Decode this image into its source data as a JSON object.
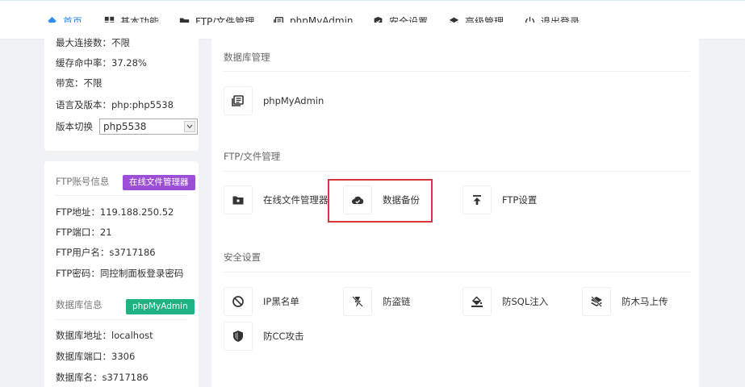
{
  "nav": {
    "items": [
      {
        "label": "首页",
        "icon": "home-icon"
      },
      {
        "label": "基本功能",
        "icon": "grid-icon"
      },
      {
        "label": "FTP/文件管理",
        "icon": "folder-icon"
      },
      {
        "label": "phpMyAdmin",
        "icon": "database-icon"
      },
      {
        "label": "安全设置",
        "icon": "shield-icon"
      },
      {
        "label": "高级管理",
        "icon": "layers-icon"
      },
      {
        "label": "退出登录",
        "icon": "power-icon"
      }
    ],
    "active_color": "#2d8cf0"
  },
  "left_top": {
    "max_conn": "最大连接数：不限",
    "cache_hit": "缓存命中率：37.28%",
    "bandwidth": "带宽：不限",
    "lang_version": "语言及版本：php:php5538",
    "version_switch_label": "版本切换",
    "version_selected": "php5538"
  },
  "ftp_info": {
    "title": "FTP账号信息",
    "button": "在线文件管理器",
    "address": "FTP地址：119.188.250.52",
    "port": "FTP端口：21",
    "user": "FTP用户名：s3717186",
    "password": "FTP密码：同控制面板登录密码"
  },
  "db_info": {
    "title": "数据库信息",
    "button": "phpMyAdmin",
    "address": "数据库地址：localhost",
    "port": "数据库端口：3306",
    "name": "数据库名：s3717186"
  },
  "main": {
    "groups": [
      {
        "title": "数据库管理",
        "tools": [
          {
            "label": "phpMyAdmin",
            "icon": "database-icon"
          }
        ]
      },
      {
        "title": "FTP/文件管理",
        "tools": [
          {
            "label": "在线文件管理器",
            "icon": "folder-icon"
          },
          {
            "label": "数据备份",
            "icon": "cloud-icon"
          },
          {
            "label": "FTP设置",
            "icon": "upload-icon"
          }
        ]
      },
      {
        "title": "安全设置",
        "tools": [
          {
            "label": "IP黑名单",
            "icon": "block-icon"
          },
          {
            "label": "防盗链",
            "icon": "flash-off-icon"
          },
          {
            "label": "防SQL注入",
            "icon": "paint-bucket-icon"
          },
          {
            "label": "防木马上传",
            "icon": "layers-off-icon"
          },
          {
            "label": "防CC攻击",
            "icon": "shield-icon"
          }
        ]
      }
    ]
  },
  "colors": {
    "purple_button": "#9c4fd6",
    "green_button": "#20b282",
    "highlight_border": "#d9363e"
  }
}
